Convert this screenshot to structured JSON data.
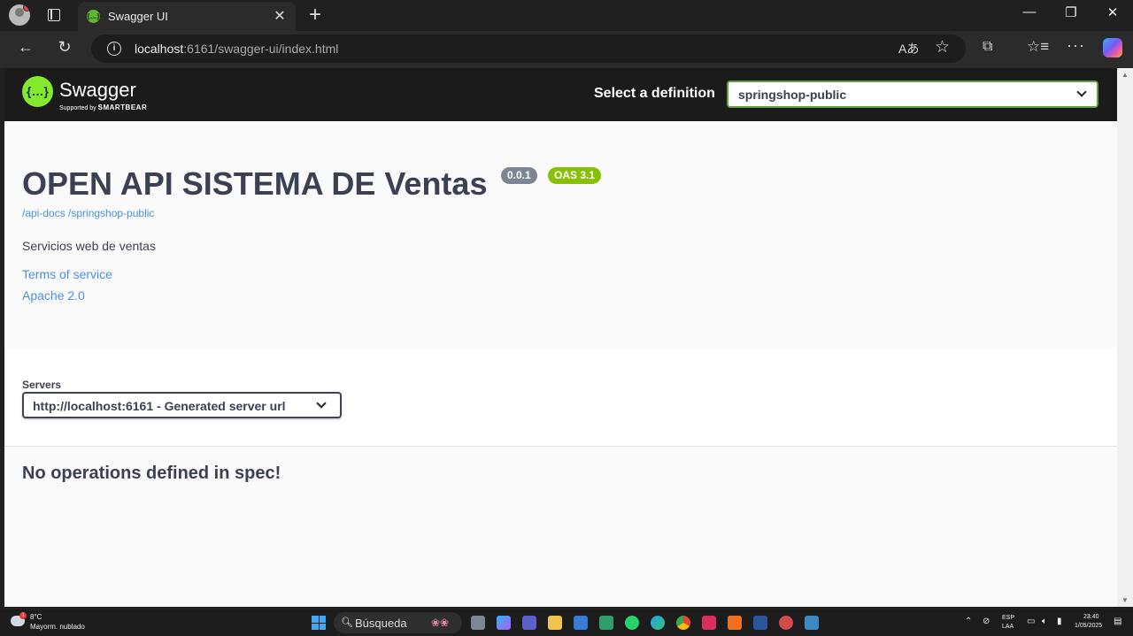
{
  "browser": {
    "tab_title": "Swagger UI",
    "tab_favicon": "{…}",
    "url_host": "localhost",
    "url_rest": ":6161/swagger-ui/index.html"
  },
  "swagger": {
    "logo_mark": "{…}",
    "logo_name": "Swagger",
    "logo_supported": "Supported by",
    "logo_smartbear": "SMARTBEAR",
    "select_label": "Select a definition",
    "selected_definition": "springshop-public",
    "title": "OPEN API SISTEMA DE Ventas",
    "version_badge": "0.0.1",
    "oas_badge": "OAS 3.1",
    "spec_url": "/api-docs /springshop-public",
    "description": "Servicios web de ventas",
    "terms_link": "Terms of service",
    "license_link": "Apache 2.0",
    "servers_label": "Servers",
    "selected_server": "http://localhost:6161 - Generated server url",
    "empty_message": "No operations defined in spec!"
  },
  "taskbar": {
    "weather_temp": "8°C",
    "weather_desc": "Mayorm. nublado",
    "weather_badge": "1",
    "search_label": "Búsqueda",
    "lang_primary": "ESP",
    "lang_secondary": "LAA",
    "time": "23:40",
    "date": "1/05/2025"
  },
  "colors": {
    "swagger_green": "#85ea2d",
    "link_blue": "#4990e2",
    "text_dark": "#3b4151",
    "badge_grey": "#7d8492",
    "badge_green": "#89bf04"
  }
}
